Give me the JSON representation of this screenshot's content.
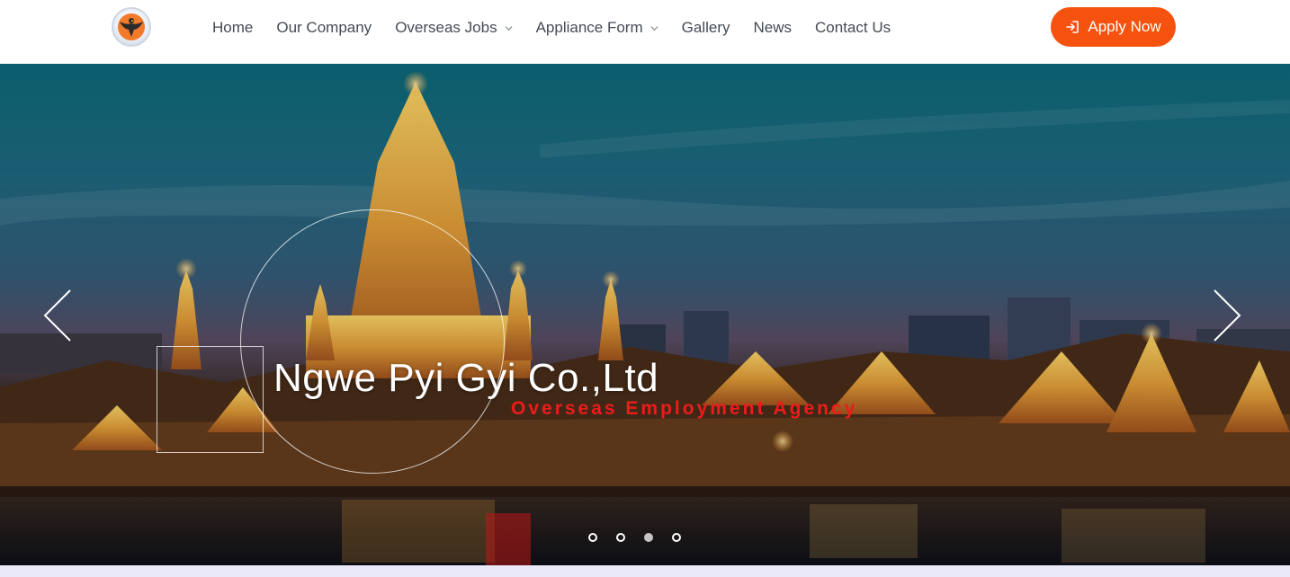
{
  "nav": {
    "items": [
      {
        "label": "Home",
        "has_dropdown": false
      },
      {
        "label": "Our Company",
        "has_dropdown": false
      },
      {
        "label": "Overseas Jobs",
        "has_dropdown": true
      },
      {
        "label": "Appliance Form",
        "has_dropdown": true
      },
      {
        "label": "Gallery",
        "has_dropdown": false
      },
      {
        "label": "News",
        "has_dropdown": false
      },
      {
        "label": "Contact Us",
        "has_dropdown": false
      }
    ],
    "apply_label": "Apply Now"
  },
  "hero": {
    "title": "Ngwe Pyi Gyi Co.,Ltd",
    "subtitle": "Overseas Employment Agency",
    "slide_count": 4,
    "active_slide": 3
  },
  "colors": {
    "accent": "#f5520f",
    "subtitle": "#ee1b1b",
    "nav_text": "#444b55"
  },
  "icons": {
    "logo": "eagle-logo",
    "apply": "sign-in-icon",
    "prev": "chevron-left-icon",
    "next": "chevron-right-icon",
    "dropdown": "chevron-down-icon"
  }
}
